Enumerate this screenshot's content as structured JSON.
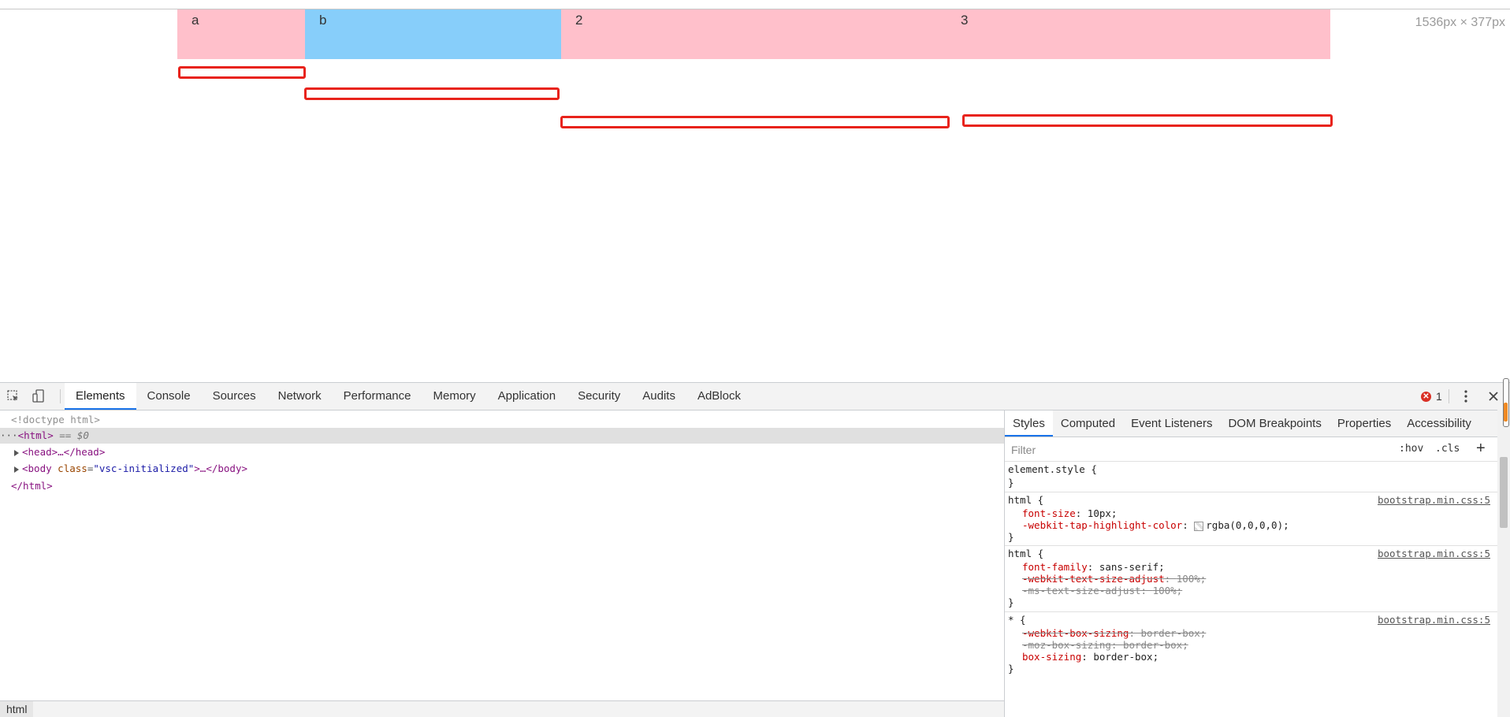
{
  "viewport": {
    "cells": [
      "a",
      "b",
      "2",
      "3"
    ],
    "dimension_readout": "1536px × 377px"
  },
  "devtools": {
    "tabs": [
      "Elements",
      "Console",
      "Sources",
      "Network",
      "Performance",
      "Memory",
      "Application",
      "Security",
      "Audits",
      "AdBlock"
    ],
    "active_tab": "Elements",
    "error_count": "1",
    "dom": {
      "doctype": "<!doctype html>",
      "html_open": "<html>",
      "html_marker": "== $0",
      "head": "<head>…</head>",
      "body_tag_open": "<body",
      "body_attr_name": "class",
      "body_attr_value": "\"vsc-initialized\"",
      "body_rest": ">…</body>",
      "html_close": "</html>"
    },
    "breadcrumb": "html",
    "styles": {
      "subtabs": [
        "Styles",
        "Computed",
        "Event Listeners",
        "DOM Breakpoints",
        "Properties",
        "Accessibility"
      ],
      "active_subtab": "Styles",
      "filter_placeholder": "Filter",
      "hov": ":hov",
      "cls": ".cls",
      "add": "+",
      "rules": [
        {
          "selector": "element.style {",
          "close": "}",
          "source": "",
          "props": []
        },
        {
          "selector": "html {",
          "close": "}",
          "source": "bootstrap.min.css:5",
          "props": [
            {
              "name": "font-size",
              "value": "10px;",
              "struck": false
            },
            {
              "name": "-webkit-tap-highlight-color",
              "value": "rgba(0,0,0,0);",
              "struck": false
            }
          ]
        },
        {
          "selector": "html {",
          "close": "}",
          "source": "bootstrap.min.css:5",
          "props": [
            {
              "name": "font-family",
              "value": "sans-serif;",
              "struck": false
            },
            {
              "name": "-webkit-text-size-adjust",
              "value": "100%;",
              "struck": true
            },
            {
              "name": "-ms-text-size-adjust",
              "value": "100%;",
              "struck": true
            }
          ]
        },
        {
          "selector": "* {",
          "close": "}",
          "source": "bootstrap.min.css:5",
          "props": [
            {
              "name": "-webkit-box-sizing",
              "value": "border-box;",
              "struck": true
            },
            {
              "name": "-moz-box-sizing",
              "value": "border-box;",
              "struck": true
            },
            {
              "name": "box-sizing",
              "value": "border-box;",
              "struck": false
            }
          ]
        }
      ]
    }
  },
  "colors": {
    "pink": "#ffc0cb",
    "light_blue": "#87cefa",
    "annotation_red": "#e8231b",
    "tab_accent": "#1a73e8"
  }
}
